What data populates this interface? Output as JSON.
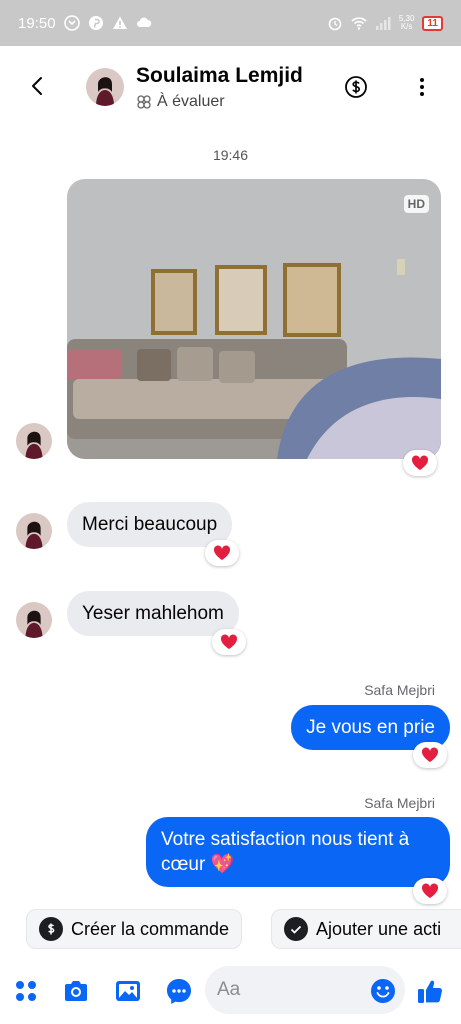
{
  "status_bar": {
    "time": "19:50",
    "net_speed_top": "5,30",
    "net_speed_bottom": "K/s",
    "battery": "11"
  },
  "header": {
    "name": "Soulaima Lemjid",
    "subtitle": "À évaluer"
  },
  "timestamp": "19:46",
  "photo": {
    "badge": "HD"
  },
  "messages": [
    {
      "text": "Merci beaucoup"
    },
    {
      "text": "Yeser mahlehom"
    },
    {
      "sender": "Safa Mejbri",
      "text": "Je vous en prie"
    },
    {
      "sender": "Safa Mejbri",
      "text": "Votre satisfaction nous tient à cœur 💖"
    }
  ],
  "quick_actions": [
    {
      "label": "Créer la commande",
      "icon": "dollar-icon"
    },
    {
      "label": "Ajouter une acti",
      "icon": "check-icon"
    }
  ],
  "composer": {
    "placeholder": "Aa"
  },
  "colors": {
    "accent": "#0a66f5",
    "incoming_bubble": "#e9ebee",
    "heart": "#e41e3f",
    "status_bar": "#c8c8c8"
  }
}
